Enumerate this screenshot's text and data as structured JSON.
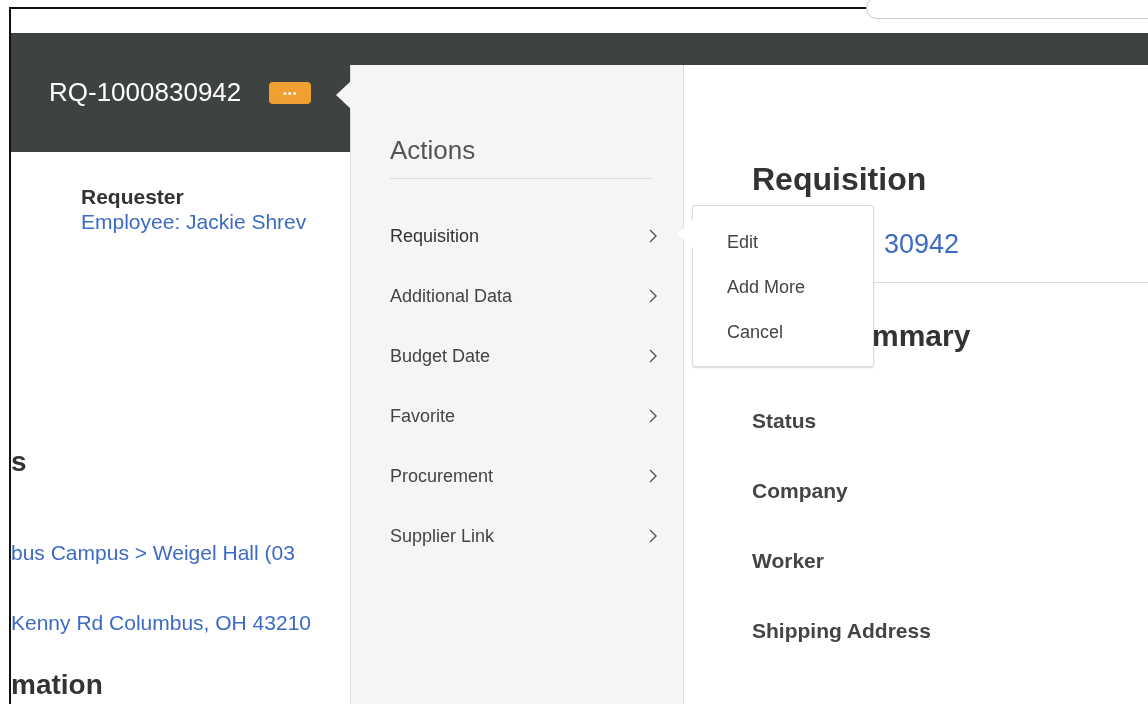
{
  "header": {
    "title": "RQ-1000830942",
    "more_button": "•••"
  },
  "left": {
    "requester_label": "Requester",
    "requester_value": "Employee: Jackie Shrev",
    "section_heading": "s",
    "location": "bus Campus > Weigel Hall (03",
    "address": "Kenny Rd Columbus, OH 43210",
    "bottom_heading": "mation"
  },
  "actions": {
    "title": "Actions",
    "items": [
      {
        "label": "Requisition",
        "expanded": true,
        "submenu": [
          "Edit",
          "Add More",
          "Cancel"
        ]
      },
      {
        "label": "Additional Data",
        "expanded": false
      },
      {
        "label": "Budget Date",
        "expanded": false
      },
      {
        "label": "Favorite",
        "expanded": false
      },
      {
        "label": "Procurement",
        "expanded": false
      },
      {
        "label": "Supplier Link",
        "expanded": false
      }
    ]
  },
  "detail": {
    "heading": "Requisition",
    "link": "30942",
    "subheading": "mmary",
    "fields": [
      "Status",
      "Company",
      "Worker",
      "Shipping Address"
    ]
  }
}
